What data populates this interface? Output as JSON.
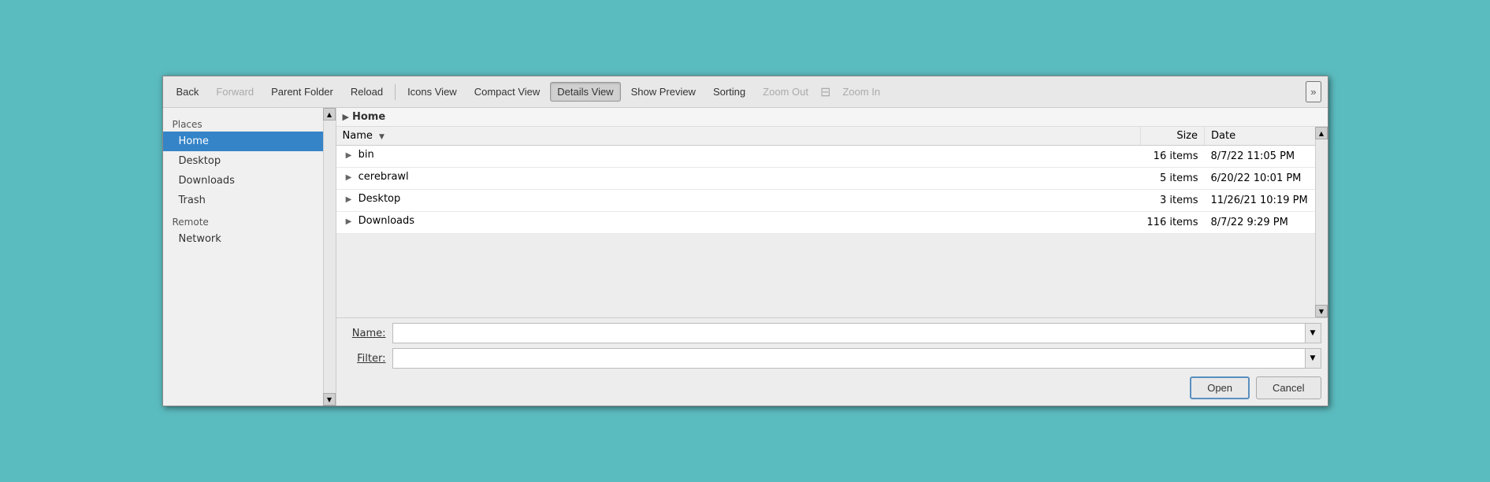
{
  "background": {
    "color": "#5bbcbf"
  },
  "toolbar": {
    "back_label": "Back",
    "forward_label": "Forward",
    "parent_folder_label": "Parent Folder",
    "reload_label": "Reload",
    "icons_view_label": "Icons View",
    "compact_view_label": "Compact View",
    "details_view_label": "Details View",
    "show_preview_label": "Show Preview",
    "sorting_label": "Sorting",
    "zoom_out_label": "Zoom Out",
    "zoom_in_label": "Zoom In",
    "overflow_label": "»"
  },
  "sidebar": {
    "places_label": "Places",
    "remote_label": "Remote",
    "items": [
      {
        "id": "home",
        "label": "Home",
        "selected": true
      },
      {
        "id": "desktop",
        "label": "Desktop",
        "selected": false
      },
      {
        "id": "downloads",
        "label": "Downloads",
        "selected": false
      },
      {
        "id": "trash",
        "label": "Trash",
        "selected": false
      }
    ],
    "remote_items": [
      {
        "id": "network",
        "label": "Network",
        "selected": false
      }
    ]
  },
  "breadcrumb": {
    "arrow": "▶",
    "path": "Home"
  },
  "file_table": {
    "columns": {
      "name": "Name",
      "size": "Size",
      "date": "Date"
    },
    "rows": [
      {
        "name": "bin",
        "size": "16 items",
        "date": "8/7/22 11:05 PM"
      },
      {
        "name": "cerebrawl",
        "size": "5 items",
        "date": "6/20/22 10:01 PM"
      },
      {
        "name": "Desktop",
        "size": "3 items",
        "date": "11/26/21 10:19 PM"
      },
      {
        "name": "Downloads",
        "size": "116 items",
        "date": "8/7/22 9:29 PM"
      }
    ]
  },
  "bottom": {
    "name_label": "Name:",
    "filter_label": "Filter:",
    "name_placeholder": "",
    "filter_placeholder": "",
    "open_label": "Open",
    "cancel_label": "Cancel"
  }
}
